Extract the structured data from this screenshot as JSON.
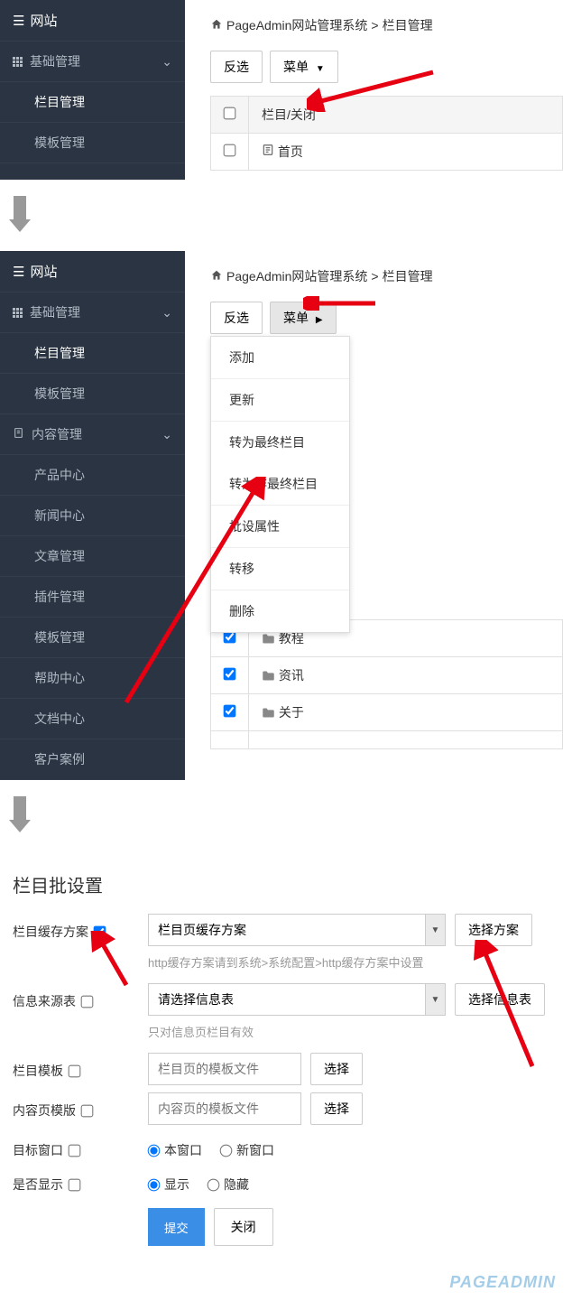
{
  "section1": {
    "sidebar": {
      "header": "网站",
      "group1": {
        "title": "基础管理",
        "items": [
          "栏目管理",
          "模板管理"
        ]
      }
    },
    "breadcrumb": {
      "site": "PageAdmin网站管理系统",
      "page": "栏目管理"
    },
    "toolbar": {
      "invert": "反选",
      "menu": "菜单"
    },
    "table": {
      "header_col": "栏目/关闭",
      "row1": "首页"
    }
  },
  "section2": {
    "sidebar": {
      "header": "网站",
      "group1": {
        "title": "基础管理",
        "items": [
          "栏目管理",
          "模板管理"
        ]
      },
      "group2": {
        "title": "内容管理",
        "items": [
          "产品中心",
          "新闻中心",
          "文章管理",
          "插件管理",
          "模板管理",
          "帮助中心",
          "文档中心",
          "客户案例"
        ]
      }
    },
    "breadcrumb": {
      "site": "PageAdmin网站管理系统",
      "page": "栏目管理"
    },
    "toolbar": {
      "invert": "反选",
      "menu": "菜单"
    },
    "menu": {
      "add": "添加",
      "update": "更新",
      "to_final": "转为最终栏目",
      "to_nonfinal": "转为非最终栏目",
      "batch_attr": "批设属性",
      "transfer": "转移",
      "delete": "删除"
    },
    "table_rows": [
      "教程",
      "资讯",
      "关于"
    ]
  },
  "section3": {
    "title": "栏目批设置",
    "cache": {
      "label": "栏目缓存方案",
      "option": "栏目页缓存方案",
      "button": "选择方案",
      "hint": "http缓存方案请到系统>系统配置>http缓存方案中设置"
    },
    "source": {
      "label": "信息来源表",
      "option": "请选择信息表",
      "button": "选择信息表",
      "hint": "只对信息页栏目有效"
    },
    "col_template": {
      "label": "栏目模板",
      "placeholder": "栏目页的模板文件",
      "button": "选择"
    },
    "content_template": {
      "label": "内容页模版",
      "placeholder": "内容页的模板文件",
      "button": "选择"
    },
    "target": {
      "label": "目标窗口",
      "opt1": "本窗口",
      "opt2": "新窗口"
    },
    "visible": {
      "label": "是否显示",
      "opt1": "显示",
      "opt2": "隐藏"
    },
    "actions": {
      "submit": "提交",
      "close": "关闭"
    }
  },
  "watermark": "PAGEADMIN"
}
